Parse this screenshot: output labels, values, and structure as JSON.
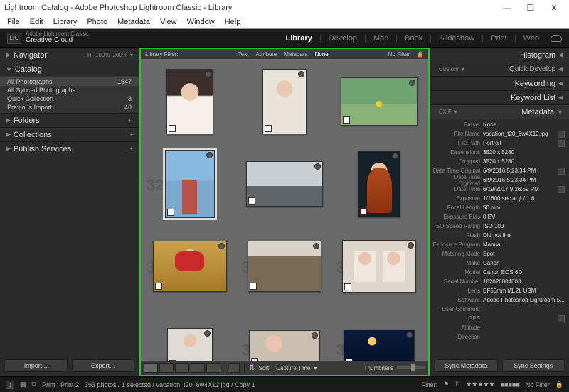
{
  "window": {
    "title": "Lightroom Catalog - Adobe Photoshop Lightroom Classic - Library"
  },
  "menu": [
    "File",
    "Edit",
    "Library",
    "Photo",
    "Metadata",
    "View",
    "Window",
    "Help"
  ],
  "identity": {
    "badge": "LrC",
    "line1": "Adobe Lightroom Classic",
    "line2": "Creative Cloud"
  },
  "modules": [
    "Library",
    "Develop",
    "Map",
    "Book",
    "Slideshow",
    "Print",
    "Web"
  ],
  "modules_active": "Library",
  "left": {
    "navigator": {
      "title": "Navigator",
      "opts": [
        "FIT",
        "100%",
        "200%"
      ]
    },
    "catalog": {
      "title": "Catalog",
      "items": [
        {
          "label": "All Photographs",
          "count": "1647"
        },
        {
          "label": "All Synced Photographs",
          "count": ""
        },
        {
          "label": "Quick Collection",
          "count": "8"
        },
        {
          "label": "Previous Import",
          "count": "40"
        }
      ]
    },
    "folders": "Folders",
    "collections": "Collections",
    "publish": "Publish Services",
    "import_btn": "Import...",
    "export_btn": "Export..."
  },
  "center": {
    "filter": {
      "label": "Library Filter:",
      "tabs": [
        "Text",
        "Attribute",
        "Metadata",
        "None"
      ],
      "active": "None",
      "right": "No Filter"
    },
    "toolbar": {
      "sort_label": "Sort:",
      "sort_value": "Capture Time",
      "thumbs": "Thumbnails"
    },
    "grid_indices": [
      "",
      "",
      "",
      "32",
      "",
      "",
      "34",
      "35",
      "36",
      "",
      "38",
      "39"
    ]
  },
  "right": {
    "histogram": "Histogram",
    "quickdev_mode": "Custom",
    "quickdev": "Quick Develop",
    "keywording": "Keywording",
    "keywordlist": "Keyword List",
    "metadata_hdr": "Metadata",
    "metadata_mode": "EXIF",
    "preset_k": "Preset",
    "preset_v": "None",
    "rows": [
      {
        "k": "File Name",
        "v": "vacation_t20_6w4X12.jpg",
        "ic": true
      },
      {
        "k": "File Path",
        "v": "Portrait",
        "ic": true
      },
      {
        "k": "Dimensions",
        "v": "3520 x 5280"
      },
      {
        "k": "Cropped",
        "v": "3520 x 5280"
      },
      {
        "k": "Date Time Original",
        "v": "6/9/2016 5:23:34 PM",
        "ic": true
      },
      {
        "k": "Date Time Digitized",
        "v": "6/9/2016 5:23:34 PM"
      },
      {
        "k": "Date Time",
        "v": "6/19/2017 9:26:59 PM",
        "ic": true
      },
      {
        "k": "Exposure",
        "v": "1/1600 sec at ƒ / 1.6"
      },
      {
        "k": "Focal Length",
        "v": "50 mm"
      },
      {
        "k": "Exposure Bias",
        "v": "0 EV"
      },
      {
        "k": "ISO Speed Rating",
        "v": "ISO 100"
      },
      {
        "k": "Flash",
        "v": "Did not fire"
      },
      {
        "k": "Exposure Program",
        "v": "Manual"
      },
      {
        "k": "Metering Mode",
        "v": "Spot"
      },
      {
        "k": "Make",
        "v": "Canon"
      },
      {
        "k": "Model",
        "v": "Canon EOS 6D"
      },
      {
        "k": "Serial Number",
        "v": "102026004603"
      },
      {
        "k": "Lens",
        "v": "EF50mm f/1.2L USM"
      },
      {
        "k": "Software",
        "v": "Adobe Photoshop Lightroom 5..."
      },
      {
        "k": "User Comment",
        "v": ""
      },
      {
        "k": "GPS",
        "v": "",
        "ic": true
      },
      {
        "k": "Altitude",
        "v": ""
      },
      {
        "k": "Direction",
        "v": ""
      }
    ],
    "sync_meta": "Sync Metadata",
    "sync_settings": "Sync Settings"
  },
  "footer": {
    "page": "1",
    "breadcrumb": "Print : Print 2",
    "status": "393 photos / 1 selected / vacation_t20_6w4X12.jpg / Copy 1",
    "filter": "Filter:",
    "nofilter": "No Filter"
  }
}
